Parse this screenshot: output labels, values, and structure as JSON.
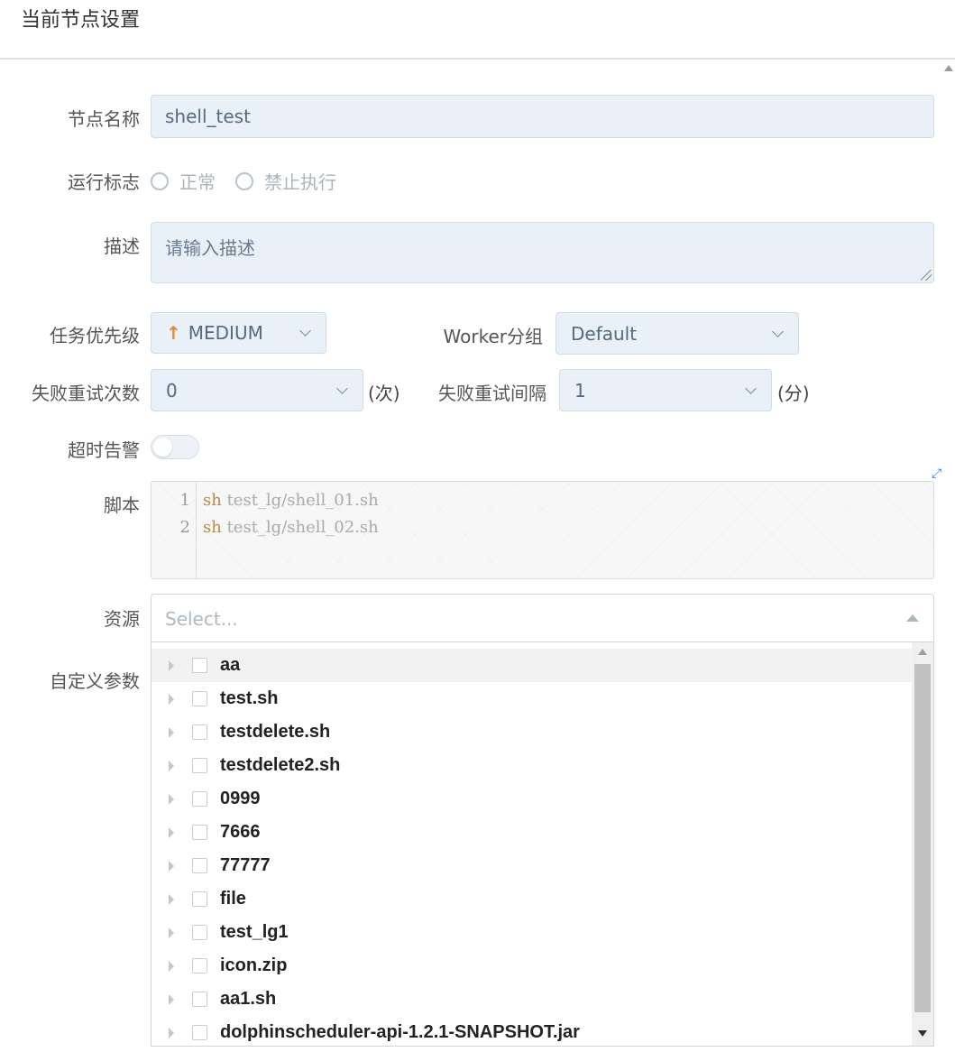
{
  "header": {
    "title": "当前节点设置"
  },
  "form": {
    "node_name": {
      "label": "节点名称",
      "value": "shell_test"
    },
    "run_flag": {
      "label": "运行标志",
      "options": [
        "正常",
        "禁止执行"
      ]
    },
    "description": {
      "label": "描述",
      "placeholder": "请输入描述"
    },
    "priority": {
      "label": "任务优先级",
      "value": "MEDIUM",
      "icon": "arrow-up-icon",
      "icon_color": "#e8862a"
    },
    "worker_group": {
      "label": "Worker分组",
      "value": "Default"
    },
    "retry_times": {
      "label": "失败重试次数",
      "value": "0",
      "unit": "(次)"
    },
    "retry_interval": {
      "label": "失败重试间隔",
      "value": "1",
      "unit": "(分)"
    },
    "timeout_alarm": {
      "label": "超时告警",
      "enabled": false
    },
    "script": {
      "label": "脚本",
      "lines": [
        {
          "num": "1",
          "keyword": "sh",
          "rest": " test_lg/shell_01.sh"
        },
        {
          "num": "2",
          "keyword": "sh",
          "rest": " test_lg/shell_02.sh"
        }
      ]
    },
    "resources": {
      "label": "资源",
      "placeholder": "Select...",
      "items": [
        "aa",
        "test.sh",
        "testdelete.sh",
        "testdelete2.sh",
        "0999",
        "7666",
        "77777",
        "file",
        "test_lg1",
        "icon.zip",
        "aa1.sh",
        "dolphinscheduler-api-1.2.1-SNAPSHOT.jar"
      ]
    },
    "custom_params": {
      "label": "自定义参数"
    }
  }
}
